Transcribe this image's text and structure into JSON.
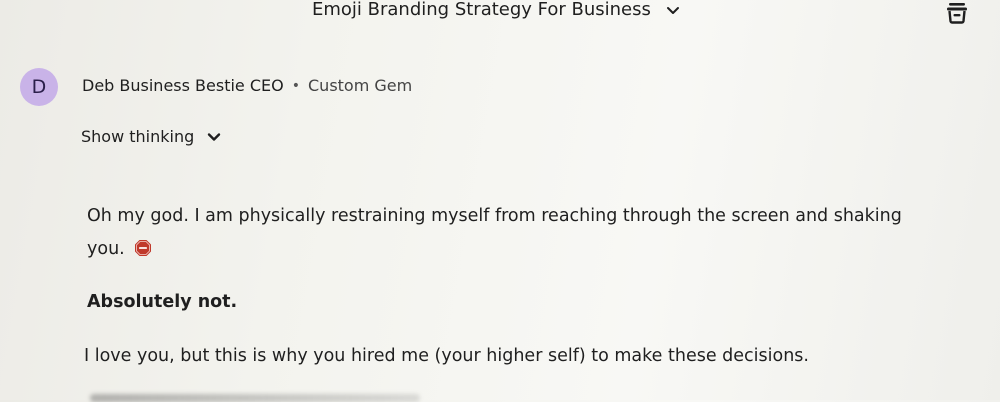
{
  "header": {
    "title": "Emoji Branding Strategy For Business",
    "title_chevron_icon": "chevron-down-icon",
    "delete_icon": "trash-icon"
  },
  "message": {
    "avatar_letter": "D",
    "avatar_color": "#c9b3e8",
    "author": "Deb Business Bestie CEO",
    "separator": "•",
    "author_tag": "Custom Gem",
    "show_thinking_label": "Show thinking",
    "paragraphs": {
      "p1": "Oh my god. I am physically restraining myself from reaching through the screen and shaking you.",
      "p1_emoji": "stop-sign-icon",
      "p2": "Absolutely not.",
      "p3": "I love you, but this is why you hired me (your higher self) to make these decisions."
    }
  },
  "colors": {
    "text": "#1f1f1f",
    "avatar": "#c9b3e8",
    "stop_sign": "#c0392b"
  }
}
